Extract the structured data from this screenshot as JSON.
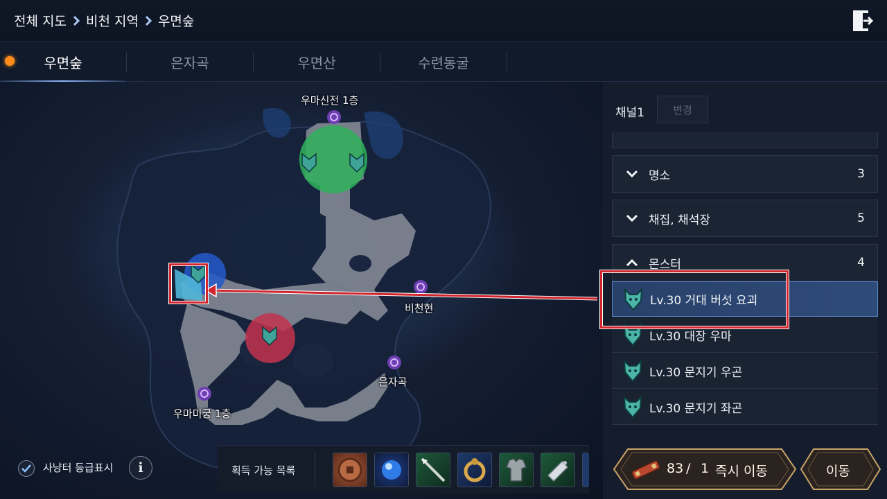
{
  "breadcrumb": [
    "전체 지도",
    "비천 지역",
    "우면숲"
  ],
  "tabs": [
    {
      "label": "우면숲",
      "active": true
    },
    {
      "label": "은자곡",
      "active": false
    },
    {
      "label": "우면산",
      "active": false
    },
    {
      "label": "수련동굴",
      "active": false
    }
  ],
  "map": {
    "labels": {
      "temple": "우마신전 1층",
      "bicheon": "비천현",
      "eunjagok": "은자곡",
      "maze": "우마미궁 1층"
    },
    "zone_colors": {
      "green": "#2fb25a",
      "red": "#c2324e",
      "blue": "#2359c9"
    }
  },
  "panel": {
    "channel_label": "채널1",
    "change_button": "변경",
    "categories": [
      {
        "label": "명소",
        "count": "3",
        "expanded": false
      },
      {
        "label": "채집, 채석장",
        "count": "5",
        "expanded": false
      },
      {
        "label": "몬스터",
        "count": "4",
        "expanded": true
      }
    ],
    "monsters": [
      {
        "label": "Lv.30 거대 버섯 요괴",
        "selected": true
      },
      {
        "label": "Lv.30 대장 우마",
        "selected": false
      },
      {
        "label": "Lv.30 문지기 우곤",
        "selected": false
      },
      {
        "label": "Lv.30 문지기 좌곤",
        "selected": false
      }
    ]
  },
  "bottom": {
    "hunting_grade_label": "사냥터 등급표시",
    "hunting_grade_checked": true,
    "info_icon": "i",
    "loot_label": "획득 가능 목록",
    "loot_items": [
      "coin-icon",
      "blue-orb-icon",
      "spear-icon",
      "dragon-ring-icon",
      "armor-icon",
      "scroll-icon"
    ]
  },
  "actions": {
    "teleport_count": "83",
    "teleport_sep": "/",
    "teleport_cost": "1",
    "teleport_label": "즉시 이동",
    "move_label": "이동"
  },
  "colors": {
    "highlight": "#d1262d",
    "accent_tab": "#8fb8ff",
    "notify_dot": "#ff8b1a",
    "button_gold": "#c9a46a"
  }
}
